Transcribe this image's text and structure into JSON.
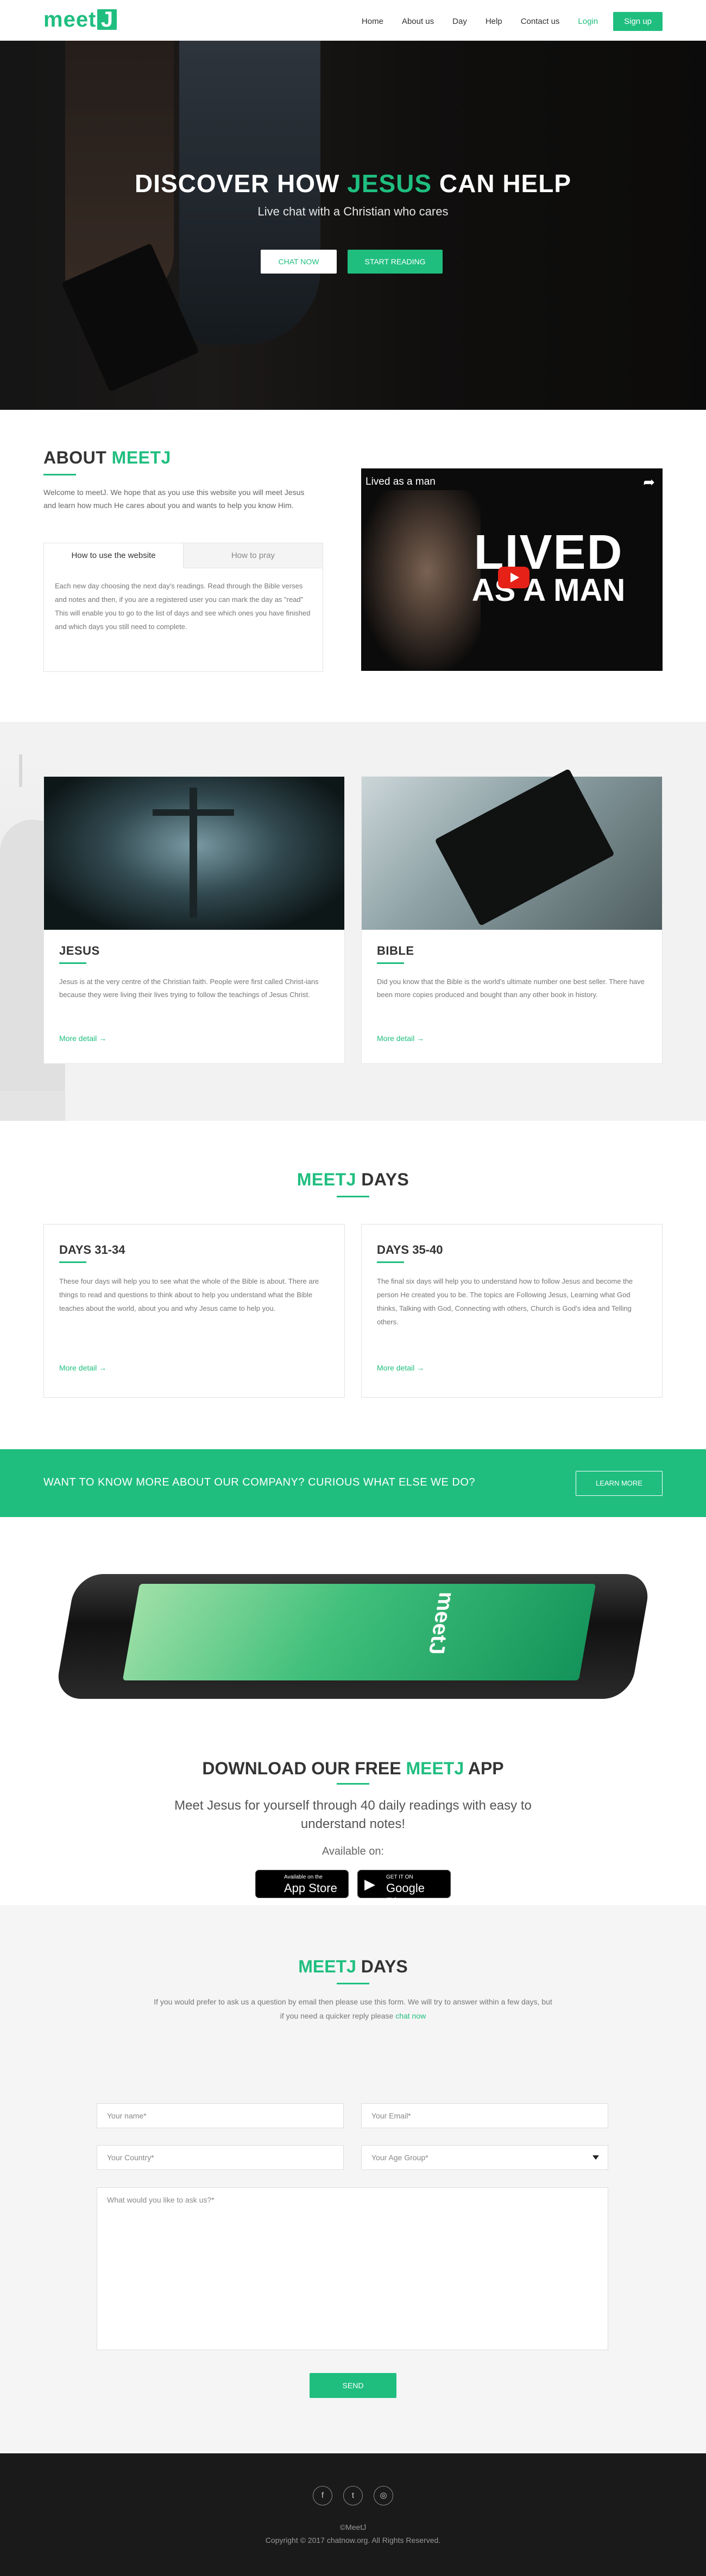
{
  "header": {
    "logo_text": "meet",
    "logo_j": "J",
    "nav": [
      "Home",
      "About us",
      "Day",
      "Help",
      "Contact us"
    ],
    "login": "Login",
    "signup": "Sign up"
  },
  "hero": {
    "title_1": "DISCOVER HOW ",
    "title_accent": "JESUS",
    "title_2": " CAN HELP",
    "subtitle": "Live chat with a Christian who cares",
    "btn_chat": "CHAT NOW",
    "btn_read": "START READING"
  },
  "about": {
    "title_1": "ABOUT ",
    "title_accent": "MEETJ",
    "intro": "Welcome to meetJ. We hope that as you use this website you will meet Jesus and learn how much He cares about you and wants to help you know Him.",
    "tabs": [
      "How to use the website",
      "How to pray"
    ],
    "tab_body": "Each new day choosing the next day's readings. Read through the Bible verses and notes and then, if you are a registered user you can mark the day as \"read\" This will enable you to go to the list of days and see which ones you have finished and which days you still need to complete.",
    "video_title": "Lived as a man",
    "video_text_1": "LIVED",
    "video_text_2": "AS A MAN"
  },
  "cards": [
    {
      "title": "JESUS",
      "text": "Jesus is at the very centre of the Christian faith. People were first called Christ-ians because they were living their lives trying to follow the teachings of Jesus Christ.",
      "more": "More detail"
    },
    {
      "title": "BIBLE",
      "text": "Did you know that the Bible is the world's ultimate number one best seller. There have been more copies produced and bought than any other book in history.",
      "more": "More detail"
    }
  ],
  "days": {
    "title_accent": "MEETJ",
    "title_2": " DAYS",
    "items": [
      {
        "title": "DAYS 31-34",
        "text": "These four days will help you to see what the whole of the Bible is about. There are things to read and questions to think about to help you understand what the Bible teaches about the world, about you and why Jesus came to help you.",
        "more": "More detail"
      },
      {
        "title": "DAYS 35-40",
        "text": "The final six days will help you to understand how to follow Jesus and become the person He created you to be. The topics are Following Jesus, Learning what God thinks, Talking with God, Connecting with others, Church is God's idea and Telling others.",
        "more": "More detail"
      }
    ]
  },
  "banner": {
    "text": "WANT TO KNOW MORE ABOUT OUR COMPANY? CURIOUS WHAT ELSE WE DO?",
    "button": "LEARN MORE"
  },
  "app": {
    "phone_logo": "meetJ",
    "title_1": "DOWNLOAD OUR FREE ",
    "title_accent": "MEETJ",
    "title_2": " APP",
    "desc": "Meet Jesus for yourself through 40 daily readings with easy to understand notes!",
    "available": "Available on:",
    "appstore_small": "Available on the",
    "appstore_big": "App Store",
    "gplay_small": "GET IT ON",
    "gplay_big": "Google Play"
  },
  "contact": {
    "title_accent": "MEETJ",
    "title_2": " DAYS",
    "note_1": "If you would prefer to ask us a question by email then please use this form. We will try to answer within a few days, but",
    "note_2": "if you need a quicker reply please ",
    "note_link": "chat now",
    "placeholders": {
      "name": "Your name*",
      "email": "Your Email*",
      "country": "Your Country*",
      "age": "Your Age Group*",
      "message": "What would you like to ask us?*"
    },
    "send": "SEND"
  },
  "footer": {
    "social": [
      "f",
      "t",
      "◎"
    ],
    "copy_1": "©MeetJ",
    "copy_2": "Copyright © 2017 chatnow.org. All Rights Reserved."
  },
  "colors": {
    "accent": "#1fbe7f",
    "footer": "#1a1a1a"
  }
}
